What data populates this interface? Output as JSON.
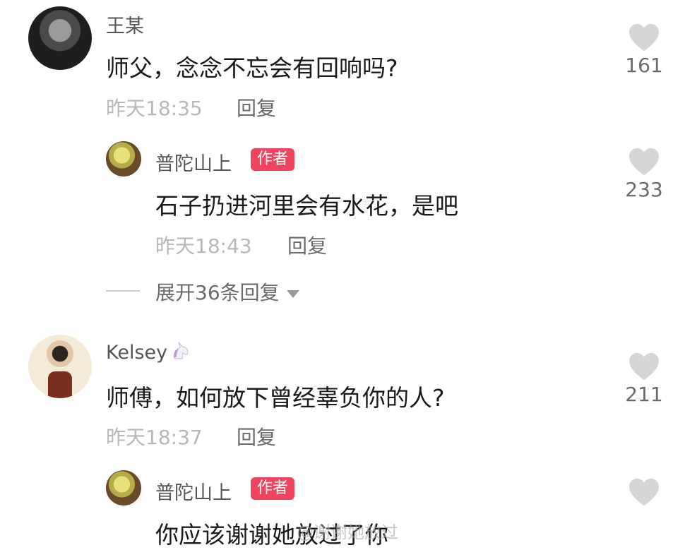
{
  "comments": [
    {
      "username": "王某",
      "text": "师父，念念不忘会有回响吗?",
      "time": "昨天18:35",
      "reply_label": "回复",
      "likes": "161"
    },
    {
      "username": "普陀山上",
      "badge": "作者",
      "text": "石子扔进河里会有水花，是吧",
      "time": "昨天18:43",
      "reply_label": "回复",
      "likes": "233"
    },
    {
      "username": "Kelsey",
      "username_emoji": "unicorn-icon",
      "text": "师傅，如何放下曾经辜负你的人?",
      "time": "昨天18:37",
      "reply_label": "回复",
      "likes": "211"
    },
    {
      "username": "普陀山上",
      "badge": "作者",
      "text": "你应该谢谢她放过了你"
    }
  ],
  "expand_replies": "展开36条回复",
  "watermark": "@谢谢她放过"
}
